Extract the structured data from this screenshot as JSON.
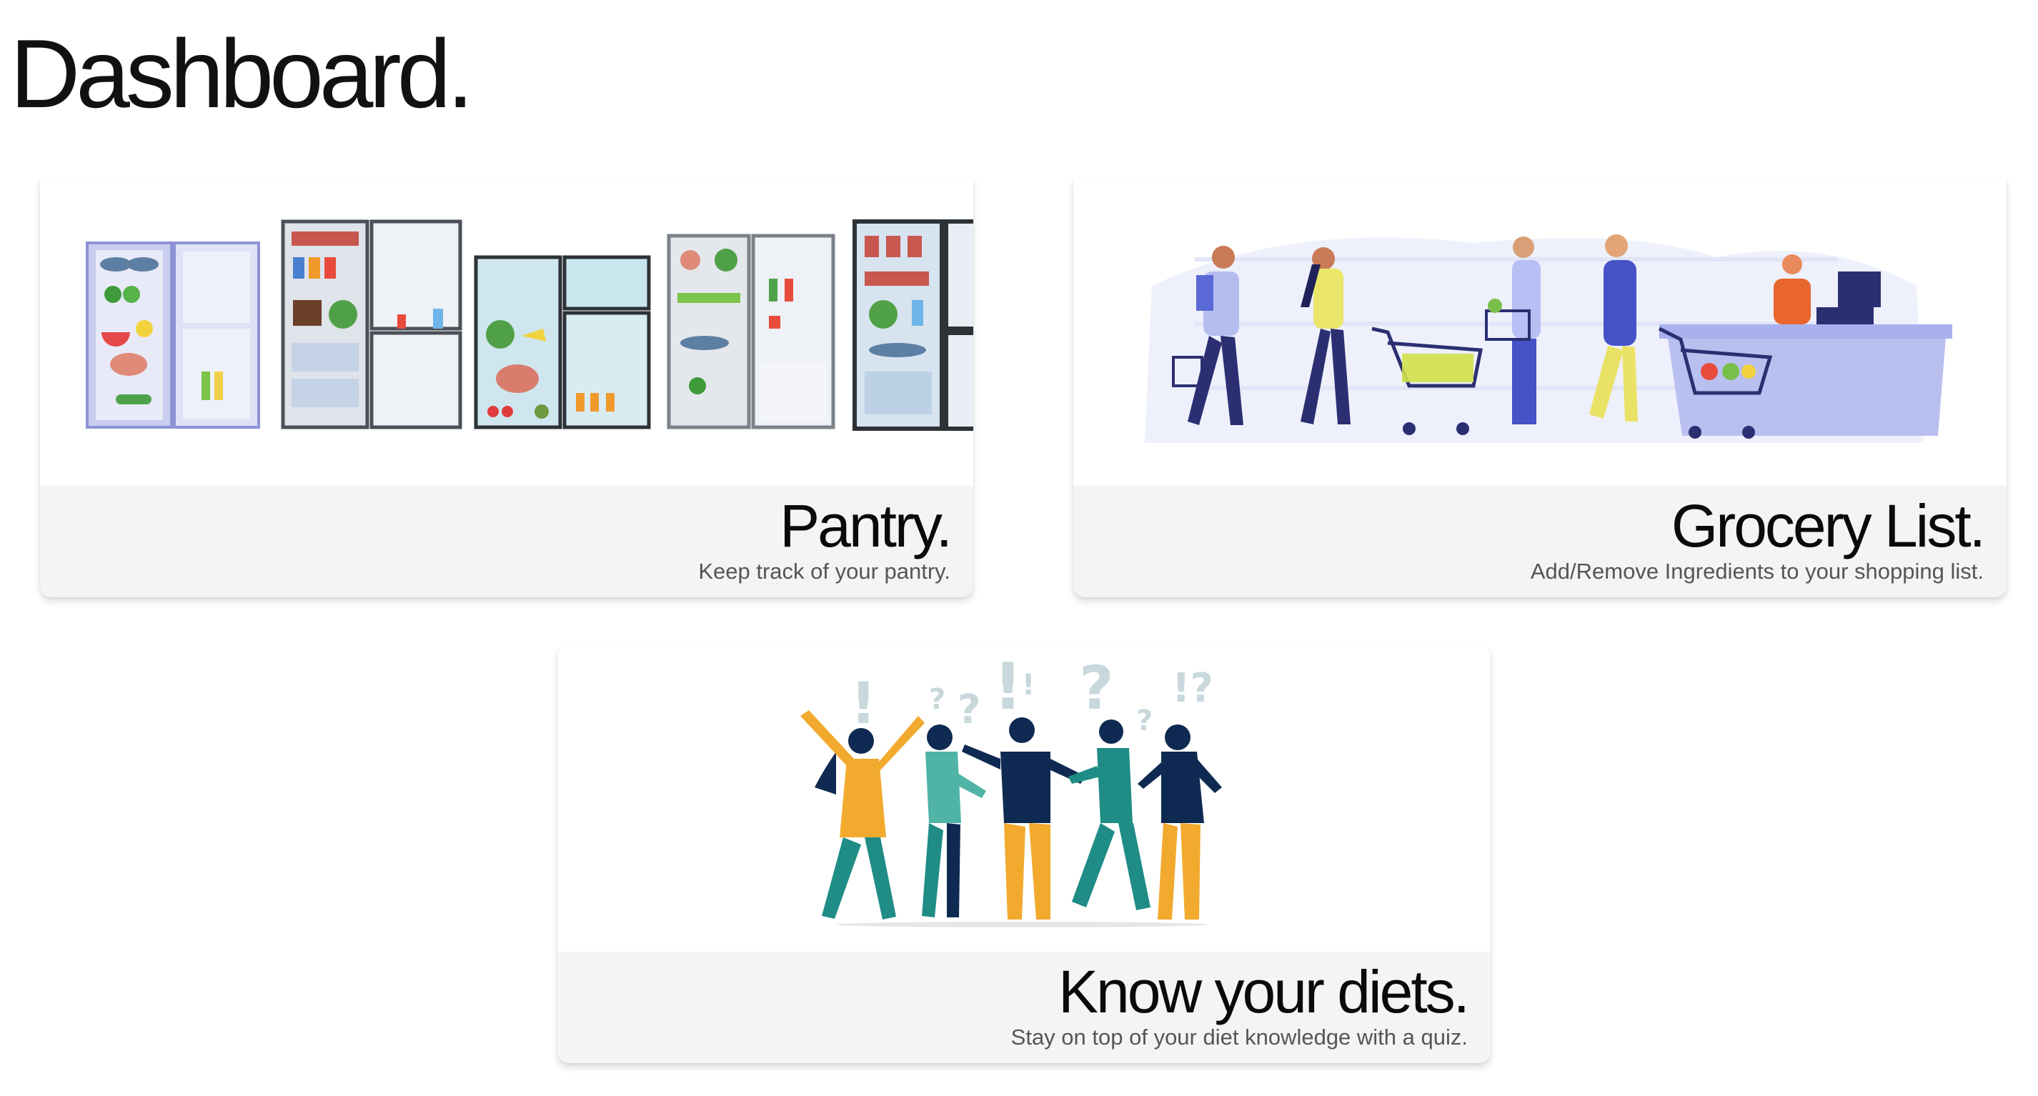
{
  "page": {
    "title": "Dashboard."
  },
  "cards": [
    {
      "id": "pantry",
      "title": "Pantry.",
      "description": "Keep track of your pantry.",
      "illustration": "open-refrigerators-illustration"
    },
    {
      "id": "grocery",
      "title": "Grocery List.",
      "description": "Add/Remove Ingredients to your shopping list.",
      "illustration": "shoppers-checkout-illustration"
    },
    {
      "id": "diets",
      "title": "Know your diets.",
      "description": "Stay on top of your diet knowledge with a quiz.",
      "illustration": "puzzled-people-illustration"
    }
  ],
  "colors": {
    "background": "#ffffff",
    "card_footer": "#f4f4f4",
    "title_text": "#0a0a0a",
    "description_text": "#555555"
  }
}
